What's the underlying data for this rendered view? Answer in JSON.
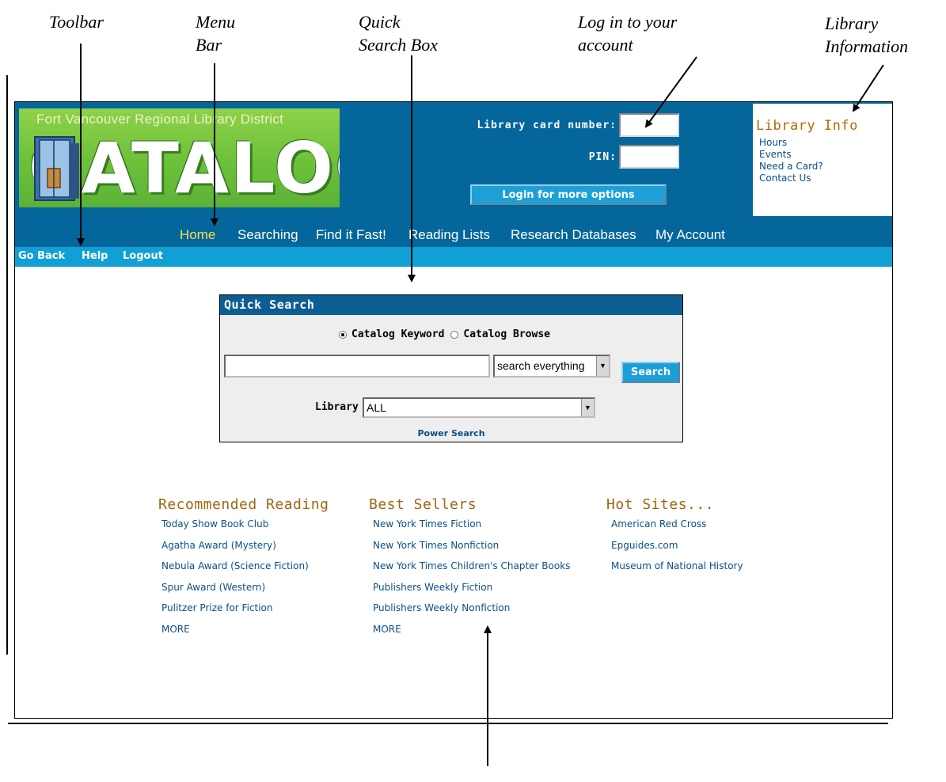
{
  "callouts": {
    "toolbar": "Toolbar",
    "menu_bar_1": "Menu",
    "menu_bar_2": "Bar",
    "quick_search_1": "Quick",
    "quick_search_2": "Search Box",
    "login_1": "Log in to your",
    "login_2": "account",
    "library_info_1": "Library",
    "library_info_2": "Information"
  },
  "header": {
    "logo_subtitle": "Fort Vancouver Regional Library District",
    "logo_word": "CATALOG",
    "card_label": "Library card number:",
    "pin_label": "PIN:",
    "login_button": "Login for more options"
  },
  "library_info": {
    "title": "Library Info",
    "links": [
      "Hours",
      "Events",
      "Need a Card?",
      "Contact Us"
    ]
  },
  "menu": {
    "items": [
      "Home",
      "Searching",
      "Find it Fast!",
      "Reading Lists",
      "Research Databases",
      "My Account"
    ],
    "active": "Home"
  },
  "toolbar": {
    "items": [
      "Go Back",
      "Help",
      "Logout"
    ]
  },
  "quick_search": {
    "title": "Quick Search",
    "radio_keyword": "Catalog Keyword",
    "radio_browse": "Catalog Browse",
    "selected_radio": "Catalog Keyword",
    "search_value": "",
    "scope_select": "search everything",
    "search_button": "Search",
    "library_label": "Library",
    "library_select": "ALL",
    "power_search": "Power Search"
  },
  "recommended": {
    "title": "Recommended Reading",
    "links": [
      "Today Show Book Club",
      "Agatha Award (Mystery)",
      "Nebula Award (Science Fiction)",
      "Spur Award (Western)",
      "Pulitzer Prize for Fiction",
      "MORE"
    ]
  },
  "best_sellers": {
    "title": "Best Sellers",
    "links": [
      "New York Times Fiction",
      "New York Times Nonfiction",
      "New York Times Children's Chapter Books",
      "Publishers Weekly Fiction",
      "Publishers Weekly Nonfiction",
      "MORE"
    ]
  },
  "hot_sites": {
    "title": "Hot Sites...",
    "links": [
      "American Red Cross",
      "Epguides.com",
      "Museum of National History"
    ]
  },
  "colors": {
    "banner": "#04669a",
    "toolbar": "#11a0d5",
    "menu_active": "#f5e04a",
    "section_title": "#a0650f",
    "link": "#0a4f8a"
  }
}
